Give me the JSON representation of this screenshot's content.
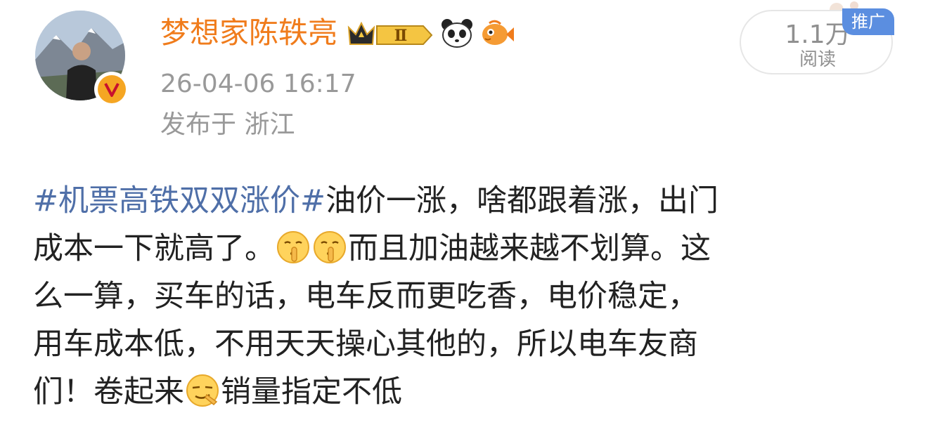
{
  "header": {
    "username": "梦想家陈轶亮",
    "level_badge": "Ⅱ",
    "timestamp": "26-04-06 16:17",
    "location": "发布于 浙江"
  },
  "stats": {
    "views": "1.1万",
    "views_label": "阅读",
    "promo_tag": "推广"
  },
  "post": {
    "hashtag": "#机票高铁双双涨价#",
    "line1_text": "油价一涨，啥都跟着涨，出门",
    "line2_a": "成本一下就高了。",
    "line2_b": "而且加油越来越不划算。这",
    "line3": "么一算，买车的话，电车反而更吃香，电价稳定，",
    "line4": "用车成本低，不用天天操心其他的，所以电车友商",
    "line5_a": "们！卷起来",
    "line5_b": "销量指定不低"
  },
  "colors": {
    "username": "#f07c1c",
    "hashtag": "#4f6fa8",
    "meta_text": "#999999",
    "promo_bg": "#5b8ee0"
  },
  "icons": {
    "verified": "verified-v-icon",
    "crown": "crown-level-icon",
    "panda": "panda-icon",
    "fish": "fish-icon",
    "emoji_shush": "shush-emoji-icon",
    "emoji_sly": "sly-emoji-icon"
  }
}
